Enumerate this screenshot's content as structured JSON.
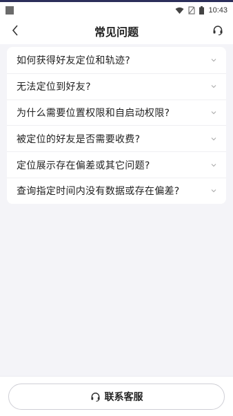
{
  "status_bar": {
    "time": "10:43",
    "icons": [
      "wifi-icon",
      "no-sim-icon",
      "battery-icon"
    ]
  },
  "header": {
    "title": "常见问题",
    "back_icon": "chevron-left-icon",
    "support_icon": "headset-icon"
  },
  "faq": {
    "items": [
      {
        "question": "如何获得好友定位和轨迹?"
      },
      {
        "question": "无法定位到好友?"
      },
      {
        "question": "为什么需要位置权限和自启动权限?"
      },
      {
        "question": "被定位的好友是否需要收费?"
      },
      {
        "question": "定位展示存在偏差或其它问题?"
      },
      {
        "question": "查询指定时间内没有数据或存在偏差?"
      }
    ],
    "chevron_icon": "chevron-down-icon"
  },
  "footer": {
    "contact_label": "联系客服",
    "contact_icon": "headset-icon"
  },
  "colors": {
    "accent_top": "#2b2e5a",
    "background": "#f4f4f8",
    "card": "#ffffff"
  }
}
